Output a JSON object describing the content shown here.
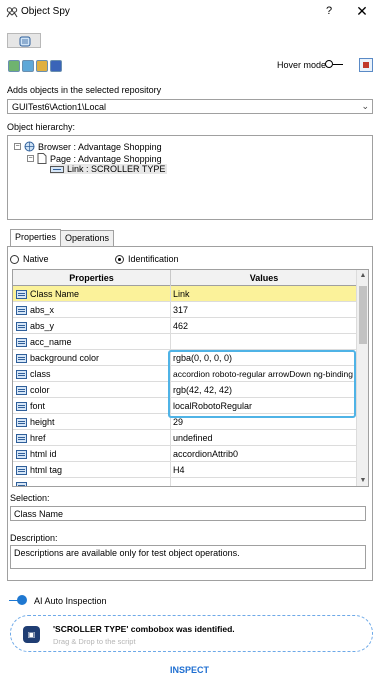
{
  "window": {
    "title": "Object Spy",
    "help": "?",
    "close": "✕"
  },
  "toolbar": {
    "hover_mode": "Hover mode"
  },
  "repo": {
    "label": "Adds objects in the selected repository",
    "selected": "GUITest6\\Action1\\Local"
  },
  "hierarchy": {
    "label": "Object hierarchy:",
    "nodes": [
      {
        "toggle": "−",
        "text": "Browser : Advantage Shopping"
      },
      {
        "toggle": "−",
        "text": "Page : Advantage Shopping"
      },
      {
        "toggle": "",
        "text": "Link : SCROLLER TYPE"
      }
    ]
  },
  "tabs": [
    "Properties",
    "Operations"
  ],
  "mode": {
    "native": "Native",
    "identification": "Identification"
  },
  "grid": {
    "headers": [
      "Properties",
      "Values"
    ],
    "rows": [
      {
        "name": "Class Name",
        "value": "Link"
      },
      {
        "name": "abs_x",
        "value": "317"
      },
      {
        "name": "abs_y",
        "value": "462"
      },
      {
        "name": "acc_name",
        "value": ""
      },
      {
        "name": "background color",
        "value": "rgba(0, 0, 0, 0)"
      },
      {
        "name": "class",
        "value": "accordion roboto-regular arrowDown ng-binding"
      },
      {
        "name": "color",
        "value": "rgb(42, 42, 42)"
      },
      {
        "name": "font",
        "value": "localRobotoRegular"
      },
      {
        "name": "height",
        "value": "29"
      },
      {
        "name": "href",
        "value": "undefined"
      },
      {
        "name": "html id",
        "value": "accordionAttrib0"
      },
      {
        "name": "html tag",
        "value": "H4"
      },
      {
        "name": "",
        "value": ""
      }
    ]
  },
  "selection": {
    "label": "Selection:",
    "value": "Class Name"
  },
  "description": {
    "label": "Description:",
    "value": "Descriptions are available only for test object operations."
  },
  "ai": {
    "label": "AI Auto Inspection",
    "title": "'SCROLLER TYPE' combobox was identified.",
    "hint": "Drag & Drop to the script",
    "inspect": "INSPECT"
  }
}
